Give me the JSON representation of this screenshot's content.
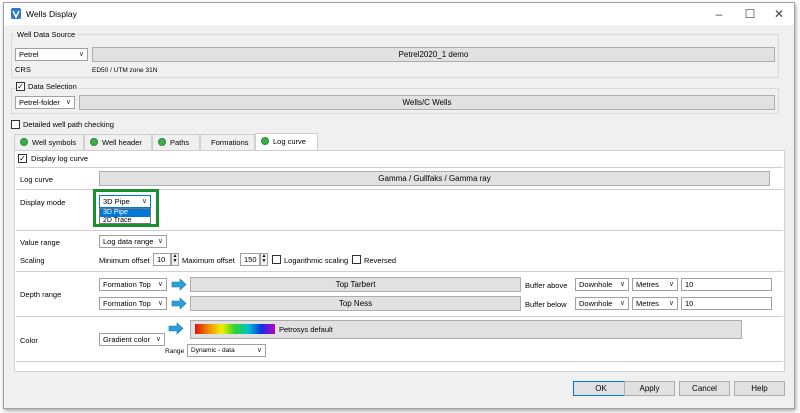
{
  "window": {
    "title": "Wells Display"
  },
  "data_source": {
    "group_title": "Well Data Source",
    "source_select": "Petrel",
    "project_button": "Petrel2020_1 demo",
    "crs_label": "CRS",
    "crs_value": "ED50 / UTM zone 31N"
  },
  "data_selection": {
    "label": "Data Selection",
    "checked": true,
    "folder_select": "Petrel-folder",
    "wells_button": "Wells/C Wells"
  },
  "detailed_check": {
    "label": "Detailed well path checking",
    "checked": false
  },
  "tabs": [
    {
      "label": "Well symbols",
      "active": false
    },
    {
      "label": "Well header",
      "active": false
    },
    {
      "label": "Paths",
      "active": false
    },
    {
      "label": "Formations",
      "active": false
    },
    {
      "label": "Log curve",
      "active": true
    }
  ],
  "log_curve": {
    "display_check_label": "Display log curve",
    "display_checked": true,
    "log_curve_label": "Log curve",
    "log_curve_button": "Gamma / Gullfaks / Gamma ray",
    "display_mode_label": "Display mode",
    "display_mode_value": "3D Pipe",
    "display_mode_options": [
      "3D Pipe",
      "2D Trace"
    ],
    "value_range_label": "Value range",
    "value_range_value": "Log data range",
    "scaling_label": "Scaling",
    "min_offset_label": "Minimum offset",
    "min_offset_value": "10",
    "max_offset_label": "Maximum offset",
    "max_offset_value": "150",
    "log_scaling_label": "Logarithmic scaling",
    "reversed_label": "Reversed",
    "depth_range_label": "Depth range",
    "depth_rows": [
      {
        "type": "Formation Top",
        "formation": "Top Tarbert",
        "buffer_label": "Buffer above",
        "direction": "Downhole",
        "unit": "Metres",
        "value": "10"
      },
      {
        "type": "Formation Top",
        "formation": "Top Ness",
        "buffer_label": "Buffer below",
        "direction": "Downhole",
        "unit": "Metres",
        "value": "10"
      }
    ],
    "color_label": "Color",
    "color_mode": "Gradient color",
    "color_scale_name": "Petrosys default",
    "range_label": "Range",
    "range_value": "Dynamic - data"
  },
  "buttons": {
    "ok": "OK",
    "apply": "Apply",
    "cancel": "Cancel",
    "help": "Help"
  },
  "colors": {
    "highlight_box": "#1a8f2e",
    "selection_blue": "#0078d7",
    "arrow_blue": "#2a9fd8"
  }
}
